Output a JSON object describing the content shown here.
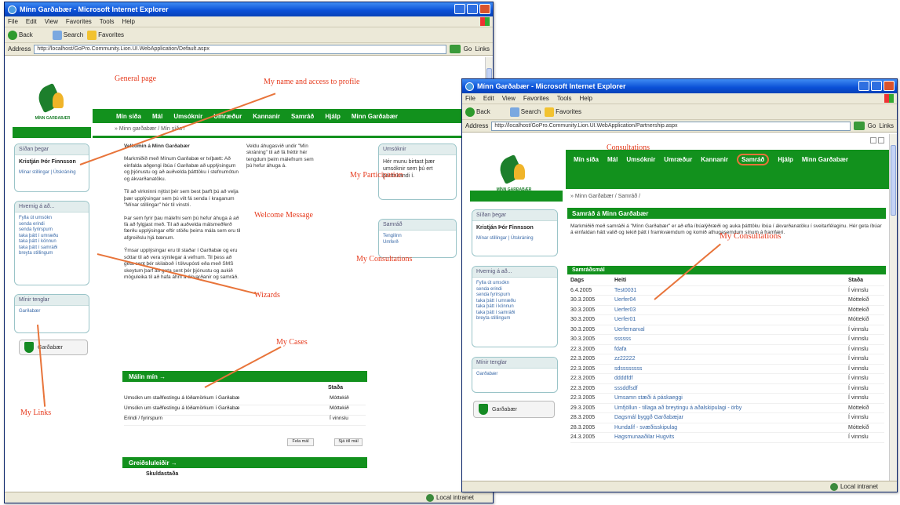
{
  "window1": {
    "title": "Mínn Garðabær - Microsoft Internet Explorer",
    "menu": [
      "File",
      "Edit",
      "View",
      "Favorites",
      "Tools",
      "Help"
    ],
    "toolbar": {
      "back": "Back",
      "search": "Search",
      "favorites": "Favorites"
    },
    "address_label": "Address",
    "address_url": "http://localhost/GoPro.Community.Lion.UI.WebApplication/Default.aspx",
    "go_label": "Go",
    "links_label": "Links",
    "status": "Local intranet",
    "page": {
      "logo_caption": "MÍNN GARÐABÆR",
      "nav": [
        "Mín síða",
        "Mál",
        "Umsóknir",
        "Umræður",
        "Kannanir",
        "Samráð",
        "Hjálp",
        "Minn Garðabær"
      ],
      "breadcrumb": "» Minn garðabær / Mín síða /",
      "login_box": {
        "header": "Síðan þegar",
        "name": "Kristján Þór Finnsson",
        "link": "Mínar stillingar | Útskráning"
      },
      "howto_box": {
        "header": "Hvernig á að...",
        "links": [
          "Fylla út umsókn",
          "senda erindi",
          "senda fyrirspurn",
          "taka þátt í umræðu",
          "taka þátt í könnun",
          "taka þátt í samráði",
          "breyta stillingum"
        ]
      },
      "shortcuts_box": {
        "header": "Mínir tenglar",
        "link": "Garðabær"
      },
      "gbutton": "Garðabær",
      "welcome": {
        "title": "Velkomin á Minn Garðabær",
        "p1": "Markmiðið með Mínum Garðabæ er tvíþætt: Að einfalda aðgengi íbúa í Garðabæ að upplýsingum og þjónustu og að auðvelda þátttöku í stefnumótun og ákvarðanatöku.",
        "p2": "Til að virkninni nýtist þér sem best þarft þú að velja þær upplýsingar sem þú vilt fá senda í kraganum \"Mínar stillingar\" hér til vinstri.",
        "p3": "Þar sem fyrir þau málefni sem þú hefur áhuga á að fá að fylgjast með. Til að auðvelda málsmeðferð færðu upplýsingar eftir stöðu þeirra mála sem eru til afgreiðslu hjá bænum.",
        "p4": "Ýmsar upplýsingar eru til staðar í Garðabæ og eru sóttar til að vera sýnilegar á vefnum. Til þess að geta sent þér skilaboð í tölvupósti eða með SMS skeytum þarf að geta sent þér þjónustu og aukið möguleika til að hafa áhrif á ákvarðanir og samráð.",
        "col2": "Veldu áhugasvið undir \"Mín skráning\" til að fá fréttir hér tengdum þeim málefnum sem þú hefur áhuga á."
      },
      "news_box": {
        "header": "Umsóknir",
        "body": "Hér munu birtast þær umsóknir sem þú ert þátttakandi í."
      },
      "consult_box": {
        "header": "Samráð",
        "links": [
          "Tengilinn",
          "Umferð"
        ]
      },
      "cases": {
        "header": "Málin mín →",
        "col_status": "Staða",
        "rows": [
          {
            "name": "Umsókn um staðfestingu á lóðamörkum í Garðabæ",
            "status": "Móttekið"
          },
          {
            "name": "Umsókn um staðfestingu á lóðamörkum í Garðabæ",
            "status": "Móttekið"
          },
          {
            "name": "Erindi / fyrirspurn",
            "status": "Í vinnslu"
          }
        ],
        "btn1": "Fela mál",
        "btn2": "Sjá öll mál"
      },
      "contacts": {
        "header": "Greiðsluleiðir →",
        "sub": "Skuldastaða"
      }
    },
    "annotations": {
      "general": "General page",
      "name": "My name and access to profile",
      "participation": "My Participation",
      "welcome": "Welcome Message",
      "consultation": "My Consultations",
      "wizards": "Wizards",
      "cases": "My Cases",
      "links": "My Links"
    }
  },
  "window2": {
    "title": "Mínn Garðabær - Microsoft Internet Explorer",
    "menu": [
      "File",
      "Edit",
      "View",
      "Favorites",
      "Tools",
      "Help"
    ],
    "toolbar": {
      "back": "Back",
      "search": "Search",
      "favorites": "Favorites"
    },
    "address_label": "Address",
    "address_url": "http://localhost/GoPro.Community.Lion.UI.WebApplication/Partnership.aspx",
    "go_label": "Go",
    "links_label": "Links",
    "status": "Local intranet",
    "page": {
      "logo_caption": "MÍNN GARÐABÆR",
      "nav": [
        "Mín síða",
        "Mál",
        "Umsóknir",
        "Umræður",
        "Kannanir",
        "Samráð",
        "Hjálp",
        "Minn Garðabær"
      ],
      "breadcrumb": "» Minn Garðabær / Samráð /",
      "login_box": {
        "header": "Síðan þegar",
        "name": "Kristján Þór Finnsson",
        "link": "Mínar stillingar | Útskráning"
      },
      "howto_box": {
        "header": "Hvernig á að...",
        "links": [
          "Fylla út umsókn",
          "senda erindi",
          "senda fyrirspurn",
          "taka þátt í umræðu",
          "taka þátt í könnun",
          "taka þátt í samráði",
          "breyta stillingum"
        ]
      },
      "shortcuts_box": {
        "header": "Mínir tenglar",
        "link": "Garðabær"
      },
      "gbutton": "Garðabær",
      "consult_title": "Samráð á Minn Garðabær",
      "consult_text": "Markmiðið með samráði á \"Mínn Garðabær\" er að efla íbúalýðræði og auka þátttöku íbúa í ákvarðanatöku í sveitarfélaginu. Hér geta íbúar á einfaldan hátt valið og tekið þátt í framkvæmdum og komið athugasemdum sínum á framfæri.",
      "list_header": "Samráðsmál",
      "cols": {
        "date": "Dags",
        "title": "Heiti",
        "status": "Staða"
      },
      "rows": [
        {
          "date": "6.4.2005",
          "title": "Test0031",
          "status": "Í vinnslu"
        },
        {
          "date": "30.3.2005",
          "title": "Uerfer04",
          "status": "Móttekið"
        },
        {
          "date": "30.3.2005",
          "title": "Uerfer03",
          "status": "Móttekið"
        },
        {
          "date": "30.3.2005",
          "title": "Uerfer01",
          "status": "Móttekið"
        },
        {
          "date": "30.3.2005",
          "title": "Uerfernarval",
          "status": "Í vinnslu"
        },
        {
          "date": "30.3.2005",
          "title": "ssssss",
          "status": "Í vinnslu"
        },
        {
          "date": "22.3.2005",
          "title": "fdafa",
          "status": "Í vinnslu"
        },
        {
          "date": "22.3.2005",
          "title": "zz22222",
          "status": "Í vinnslu"
        },
        {
          "date": "22.3.2005",
          "title": "sdssssssss",
          "status": "Í vinnslu"
        },
        {
          "date": "22.3.2005",
          "title": "ddddfdf",
          "status": "Í vinnslu"
        },
        {
          "date": "22.3.2005",
          "title": "sssddfsdf",
          "status": "Í vinnslu"
        },
        {
          "date": "22.3.2005",
          "title": "Umsamn stæði á páskaeggi",
          "status": "Í vinnslu"
        },
        {
          "date": "29.3.2005",
          "title": "Umfjöllun - tillaga að breytingu á aðalskipulagi - örby",
          "status": "Móttekið"
        },
        {
          "date": "28.3.2005",
          "title": "Dagsmál byggð Garðabæjar",
          "status": "Í vinnslu"
        },
        {
          "date": "28.3.2005",
          "title": "Hundalíf - svæðisskipulag",
          "status": "Móttekið"
        },
        {
          "date": "24.3.2005",
          "title": "Hagsmunaaðilar Hugvits",
          "status": "Í vinnslu"
        }
      ]
    },
    "annotations": {
      "consultations": "Consultations",
      "my_consultations": "My Consultations"
    }
  },
  "colors": {
    "nav_green": "#12911d",
    "annotation_red": "#e63b1e",
    "xp_blue": "#0a4fd6",
    "xp_gray": "#ece9d8"
  }
}
